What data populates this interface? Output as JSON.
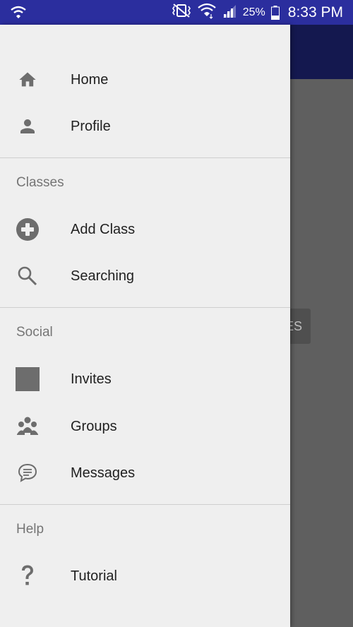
{
  "status_bar": {
    "battery": "25%",
    "time": "8:33 PM",
    "icons": [
      "wifi-calling-icon",
      "vibrate-off-icon",
      "wifi-icon",
      "signal-icon",
      "battery-icon"
    ]
  },
  "app": {
    "button_fragment": "ES"
  },
  "drawer": {
    "items_top": [
      {
        "label": "Home",
        "icon": "home-icon"
      },
      {
        "label": "Profile",
        "icon": "person-icon"
      }
    ],
    "sections": [
      {
        "header": "Classes",
        "items": [
          {
            "label": "Add Class",
            "icon": "add-circle-icon"
          },
          {
            "label": "Searching",
            "icon": "search-icon"
          }
        ]
      },
      {
        "header": "Social",
        "items": [
          {
            "label": "Invites",
            "icon": "invites-placeholder-icon"
          },
          {
            "label": "Groups",
            "icon": "group-icon"
          },
          {
            "label": "Messages",
            "icon": "chat-bubble-icon"
          }
        ]
      },
      {
        "header": "Help",
        "items": [
          {
            "label": "Tutorial",
            "icon": "help-question-icon"
          }
        ]
      }
    ]
  },
  "colors": {
    "status_bar": "#2b2e9e",
    "toolbar": "#14184f",
    "drawer_bg": "#efefef",
    "icon_gray": "#6d6d6d",
    "scrim": "#5f5f5f"
  }
}
